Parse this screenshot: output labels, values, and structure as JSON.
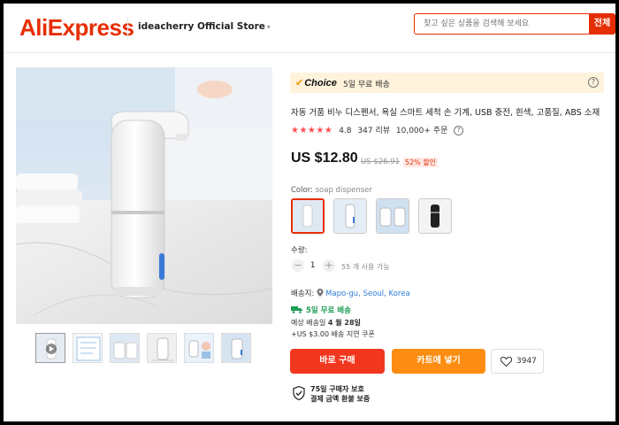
{
  "header": {
    "logo": "AliExpress",
    "store_name": "ideacherry Official Store",
    "store_caret": "▾",
    "search_placeholder": "찾고 싶은 상품을 검색해 보세요",
    "search_button": "전체"
  },
  "choice": {
    "badge": "Choice",
    "text": "5일 무료 배송",
    "help": "?"
  },
  "product": {
    "title": "자동 거품 비누 디스펜서, 욕실 스마트 세척 손 기계, USB 충전, 흰색, 고품질, ABS 소재",
    "stars": "★★★★★",
    "rating": "4.8",
    "reviews": "347 리뷰",
    "orders": "10,000+ 주문",
    "price": "US $12.80",
    "old_price": "US $26.91",
    "discount": "52% 할인"
  },
  "color": {
    "label": "Color:",
    "value": "soap dispenser"
  },
  "quantity": {
    "label": "수량:",
    "minus": "−",
    "value": "1",
    "plus": "+",
    "available": "55 개 사용 가능"
  },
  "shipping": {
    "label": "배송지:",
    "location": "Mapo-gu, Seoul, Korea",
    "free": "5일 무료 배송",
    "eta_prefix": "예상 배송일 ",
    "eta_date": "4 월 28일",
    "coupon": "+US $3.00 배송 지연 쿠폰"
  },
  "actions": {
    "buy": "바로 구매",
    "cart": "카트에 넣기",
    "wishlist_count": "3947"
  },
  "protection": {
    "line1": "75일 구매자 보호",
    "line2": "결제 금액 환불 보증"
  },
  "colors": {
    "brand": "#e62e04",
    "buy": "#f2371f",
    "cart": "#fc8d12",
    "choice_bg": "#fff3dc",
    "free_ship": "#1f9d55",
    "location": "#2e7ed6"
  }
}
